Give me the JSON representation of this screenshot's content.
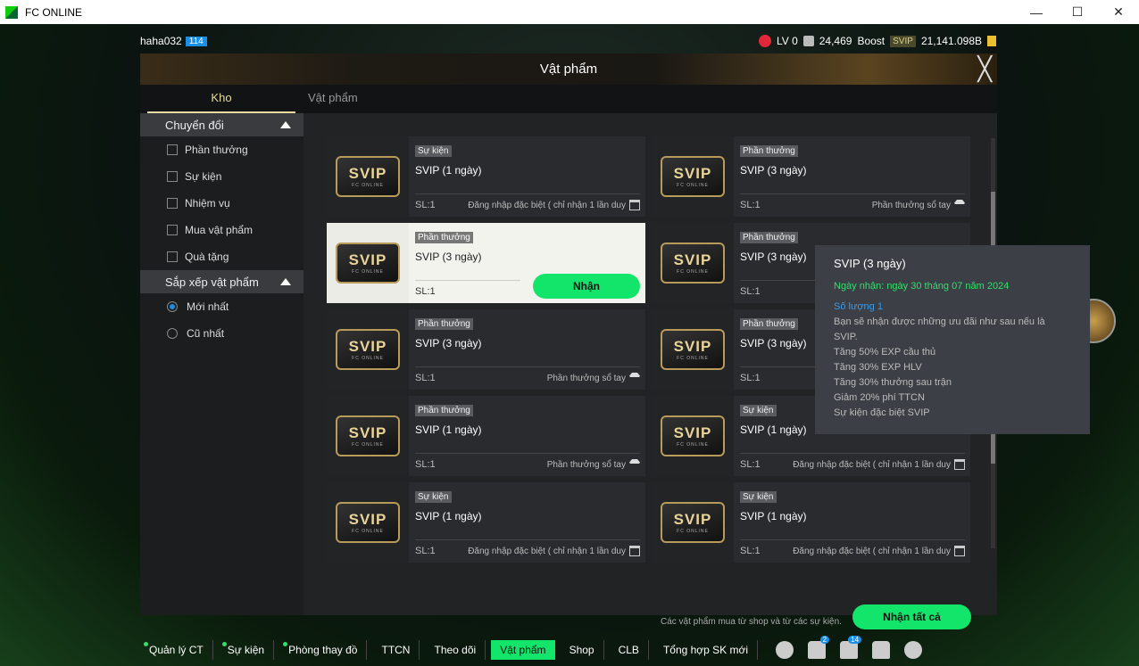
{
  "window": {
    "title": "FC ONLINE",
    "minimize": "—",
    "maximize": "☐",
    "close": "✕"
  },
  "topbar": {
    "username": "haha032",
    "level": "114",
    "lv": "LV 0",
    "points": "24,469",
    "boost": "Boost",
    "svip": "SVIP",
    "bp": "21,141.098B"
  },
  "modal": {
    "title": "Vật phẩm",
    "close": "╳",
    "tabs": [
      "Kho",
      "Vật phẩm"
    ]
  },
  "sidebar": {
    "filter_title": "Chuyển đổi",
    "filters": [
      "Phần thưởng",
      "Sự kiện",
      "Nhiệm vụ",
      "Mua vật phẩm",
      "Quà tặng"
    ],
    "sort_title": "Sắp xếp vật phẩm",
    "sorts": [
      {
        "label": "Mới nhất",
        "selected": true
      },
      {
        "label": "Cũ nhất",
        "selected": false
      }
    ]
  },
  "cards": [
    {
      "tag": "Sự kiện",
      "name": "SVIP (1 ngày)",
      "qty": "SL:1",
      "source": "Đăng nhập đặc biệt ( chỉ nhận 1 lần duy",
      "icon": "calendar-icon"
    },
    {
      "tag": "Phần thưởng",
      "name": "SVIP (3 ngày)",
      "qty": "SL:1",
      "source": "Phần thưởng sổ tay",
      "icon": "diamond-icon"
    },
    {
      "tag": "Phần thưởng",
      "name": "SVIP (3 ngày)",
      "qty": "SL:1",
      "selected": true,
      "button": "Nhận"
    },
    {
      "tag": "Phần thưởng",
      "name": "SVIP (3 ngày)",
      "qty": "SL:1",
      "source": "Phần thưởng sổ tay",
      "icon": "diamond-icon"
    },
    {
      "tag": "Phần thưởng",
      "name": "SVIP (3 ngày)",
      "qty": "SL:1",
      "source": "Phần thưởng sổ tay",
      "icon": "diamond-icon"
    },
    {
      "tag": "Phần thưởng",
      "name": "SVIP (3 ngày)",
      "qty": "SL:1",
      "source": "Phần thưởng sổ tay",
      "icon": "diamond-icon"
    },
    {
      "tag": "Phần thưởng",
      "name": "SVIP (1 ngày)",
      "qty": "SL:1",
      "source": "Phần thưởng sổ tay",
      "icon": "diamond-icon"
    },
    {
      "tag": "Sự kiện",
      "name": "SVIP (1 ngày)",
      "qty": "SL:1",
      "source": "Đăng nhập đặc biệt ( chỉ nhận 1 lần duy",
      "icon": "calendar-icon"
    },
    {
      "tag": "Sự kiện",
      "name": "SVIP (1 ngày)",
      "qty": "SL:1",
      "source": "Đăng nhập đặc biệt ( chỉ nhận 1 lần duy",
      "icon": "calendar-icon"
    },
    {
      "tag": "Sự kiện",
      "name": "SVIP (1 ngày)",
      "qty": "SL:1",
      "source": "Đăng nhập đặc biệt ( chỉ nhận 1 lần duy",
      "icon": "calendar-icon"
    }
  ],
  "card_logo": {
    "text": "SVIP",
    "sub": "FC ONLINE"
  },
  "tooltip": {
    "title": "SVIP (3 ngày)",
    "date": "Ngày nhận:  ngày 30 tháng 07 năm 2024",
    "qty": "Số lượng 1",
    "lines": [
      "Bạn sẽ nhận được những ưu đãi như sau nếu là SVIP.",
      "Tăng 50% EXP cầu thủ",
      "Tăng 30% EXP HLV",
      "Tăng 30% thưởng sau trận",
      "Giảm 20% phí TTCN",
      " Sự kiện đặc biệt SVIP"
    ]
  },
  "footer": {
    "note": "Các vật phẩm mua từ shop và từ các sự kiện.",
    "claim_all": "Nhận tất cả"
  },
  "nav": {
    "items": [
      {
        "label": "Quản lý CT",
        "dot": true
      },
      {
        "label": "Sự kiện",
        "dot": true
      },
      {
        "label": "Phòng thay đồ",
        "dot": true
      },
      {
        "label": "TTCN"
      },
      {
        "label": "Theo dõi"
      },
      {
        "label": "Vật phẩm",
        "active": true
      },
      {
        "label": "Shop"
      },
      {
        "label": "CLB"
      },
      {
        "label": "Tổng hợp SK mới"
      }
    ],
    "icons": [
      {
        "name": "chat-icon"
      },
      {
        "name": "house-arrow-icon",
        "badge": "2"
      },
      {
        "name": "bell-icon",
        "badge": "14"
      },
      {
        "name": "person-icon"
      },
      {
        "name": "gear-icon"
      }
    ]
  },
  "colors": {
    "accent": "#13e46a",
    "tab_active": "#e8dca0",
    "level_badge": "#1a8fe8"
  }
}
